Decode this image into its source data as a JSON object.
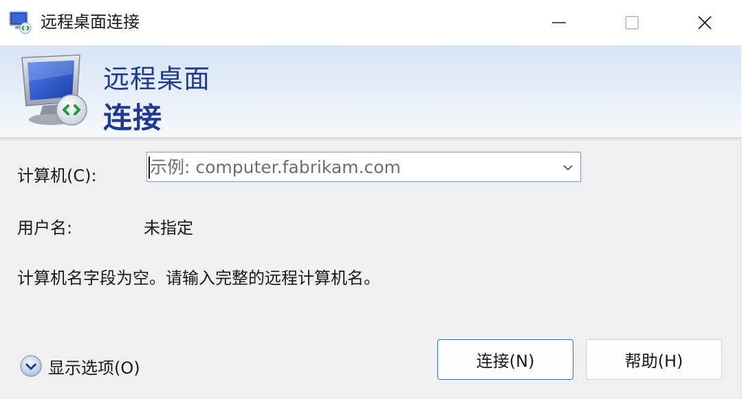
{
  "window": {
    "title": "远程桌面连接"
  },
  "banner": {
    "line1": "远程桌面",
    "line2": "连接"
  },
  "form": {
    "computer_label": "计算机(C):",
    "computer_placeholder": "示例: computer.fabrikam.com",
    "computer_value": "",
    "user_label": "用户名:",
    "user_value": "未指定",
    "message": "计算机名字段为空。请输入完整的远程计算机名。"
  },
  "footer": {
    "options_label": "显示选项(O)",
    "connect_label": "连接(N)",
    "help_label": "帮助(H)"
  },
  "icons": {
    "app": "remote-desktop-icon",
    "banner": "monitor-connection-icon",
    "minimize": "minimize-icon",
    "maximize": "maximize-icon",
    "close": "close-icon",
    "dropdown": "chevron-down-icon",
    "options": "expand-circle-icon"
  },
  "colors": {
    "banner_title": "#1f3a93",
    "accent_border": "#2f6fc9"
  }
}
